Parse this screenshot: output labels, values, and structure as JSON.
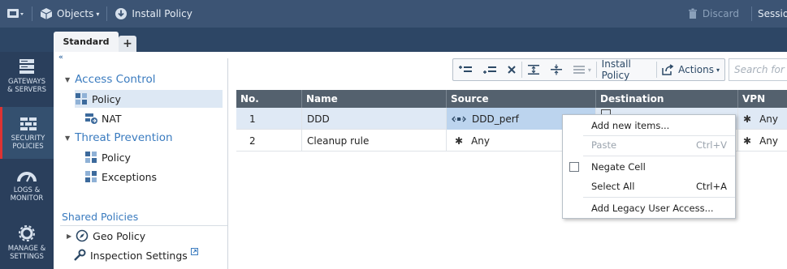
{
  "topbar": {
    "objects_label": "Objects",
    "install_policy_label": "Install Policy",
    "discard_label": "Discard",
    "session_label": "Session"
  },
  "tabs": {
    "active_tab": "Standard",
    "add_tab": "+"
  },
  "leftnav": {
    "items": [
      {
        "label_line1": "GATEWAYS",
        "label_line2": "& SERVERS"
      },
      {
        "label_line1": "SECURITY",
        "label_line2": "POLICIES"
      },
      {
        "label_line1": "LOGS &",
        "label_line2": "MONITOR"
      },
      {
        "label_line1": "MANAGE &",
        "label_line2": "SETTINGS"
      }
    ]
  },
  "tree": {
    "collapse": "«",
    "access_control": "Access Control",
    "ac_policy": "Policy",
    "ac_nat": "NAT",
    "threat_prevention": "Threat Prevention",
    "tp_policy": "Policy",
    "tp_exceptions": "Exceptions",
    "shared_policies": "Shared Policies",
    "geo_policy": "Geo Policy",
    "inspection_settings": "Inspection Settings"
  },
  "toolbar": {
    "install_policy": "Install Policy",
    "actions": "Actions"
  },
  "search": {
    "placeholder": "Search for IP"
  },
  "table": {
    "columns": [
      "No.",
      "Name",
      "Source",
      "Destination",
      "VPN"
    ],
    "rows": [
      {
        "no": "1",
        "name": "DDD",
        "source": "DDD_perf",
        "destination": "",
        "vpn": "Any"
      },
      {
        "no": "2",
        "name": "Cleanup rule",
        "source": "Any",
        "destination": "",
        "vpn": "Any"
      }
    ]
  },
  "context_menu": {
    "add_new_items": "Add new items...",
    "paste": "Paste",
    "paste_shortcut": "Ctrl+V",
    "negate_cell": "Negate Cell",
    "select_all": "Select All",
    "select_all_shortcut": "Ctrl+A",
    "add_legacy": "Add Legacy User Access..."
  }
}
